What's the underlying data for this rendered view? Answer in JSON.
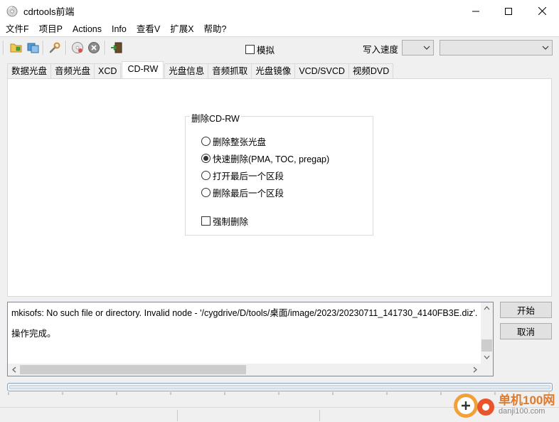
{
  "window": {
    "title": "cdrtools前端"
  },
  "menu": [
    "文件F",
    "项目P",
    "Actions",
    "Info",
    "查看V",
    "扩展X",
    "帮助?"
  ],
  "toolbar": {
    "simulate_label": "模拟",
    "write_speed_label": "写入速度",
    "write_speed_value": "",
    "device_value": ""
  },
  "tabs": [
    "数据光盘",
    "音频光盘",
    "XCD",
    "CD-RW",
    "光盘信息",
    "音频抓取",
    "光盘镜像",
    "VCD/SVCD",
    "视频DVD"
  ],
  "active_tab": "CD-RW",
  "erase_group": {
    "title": "删除CD-RW",
    "options": [
      {
        "label": "删除整张光盘",
        "selected": false
      },
      {
        "label": "快速删除(PMA, TOC, pregap)",
        "selected": true
      },
      {
        "label": "打开最后一个区段",
        "selected": false
      },
      {
        "label": "删除最后一个区段",
        "selected": false
      }
    ],
    "force_label": "强制删除",
    "force_checked": false
  },
  "log": {
    "lines": [
      "mkisofs: No such file or directory. Invalid node - '/cygdrive/D/tools/桌面/image/2023/20230711_141730_4140FB3E.diz'.",
      "操作完成。"
    ]
  },
  "buttons": {
    "start": "开始",
    "cancel": "取消"
  },
  "progress": {
    "value": 0
  },
  "watermark": {
    "line1": "单机100网",
    "line2": "danji100.com"
  }
}
